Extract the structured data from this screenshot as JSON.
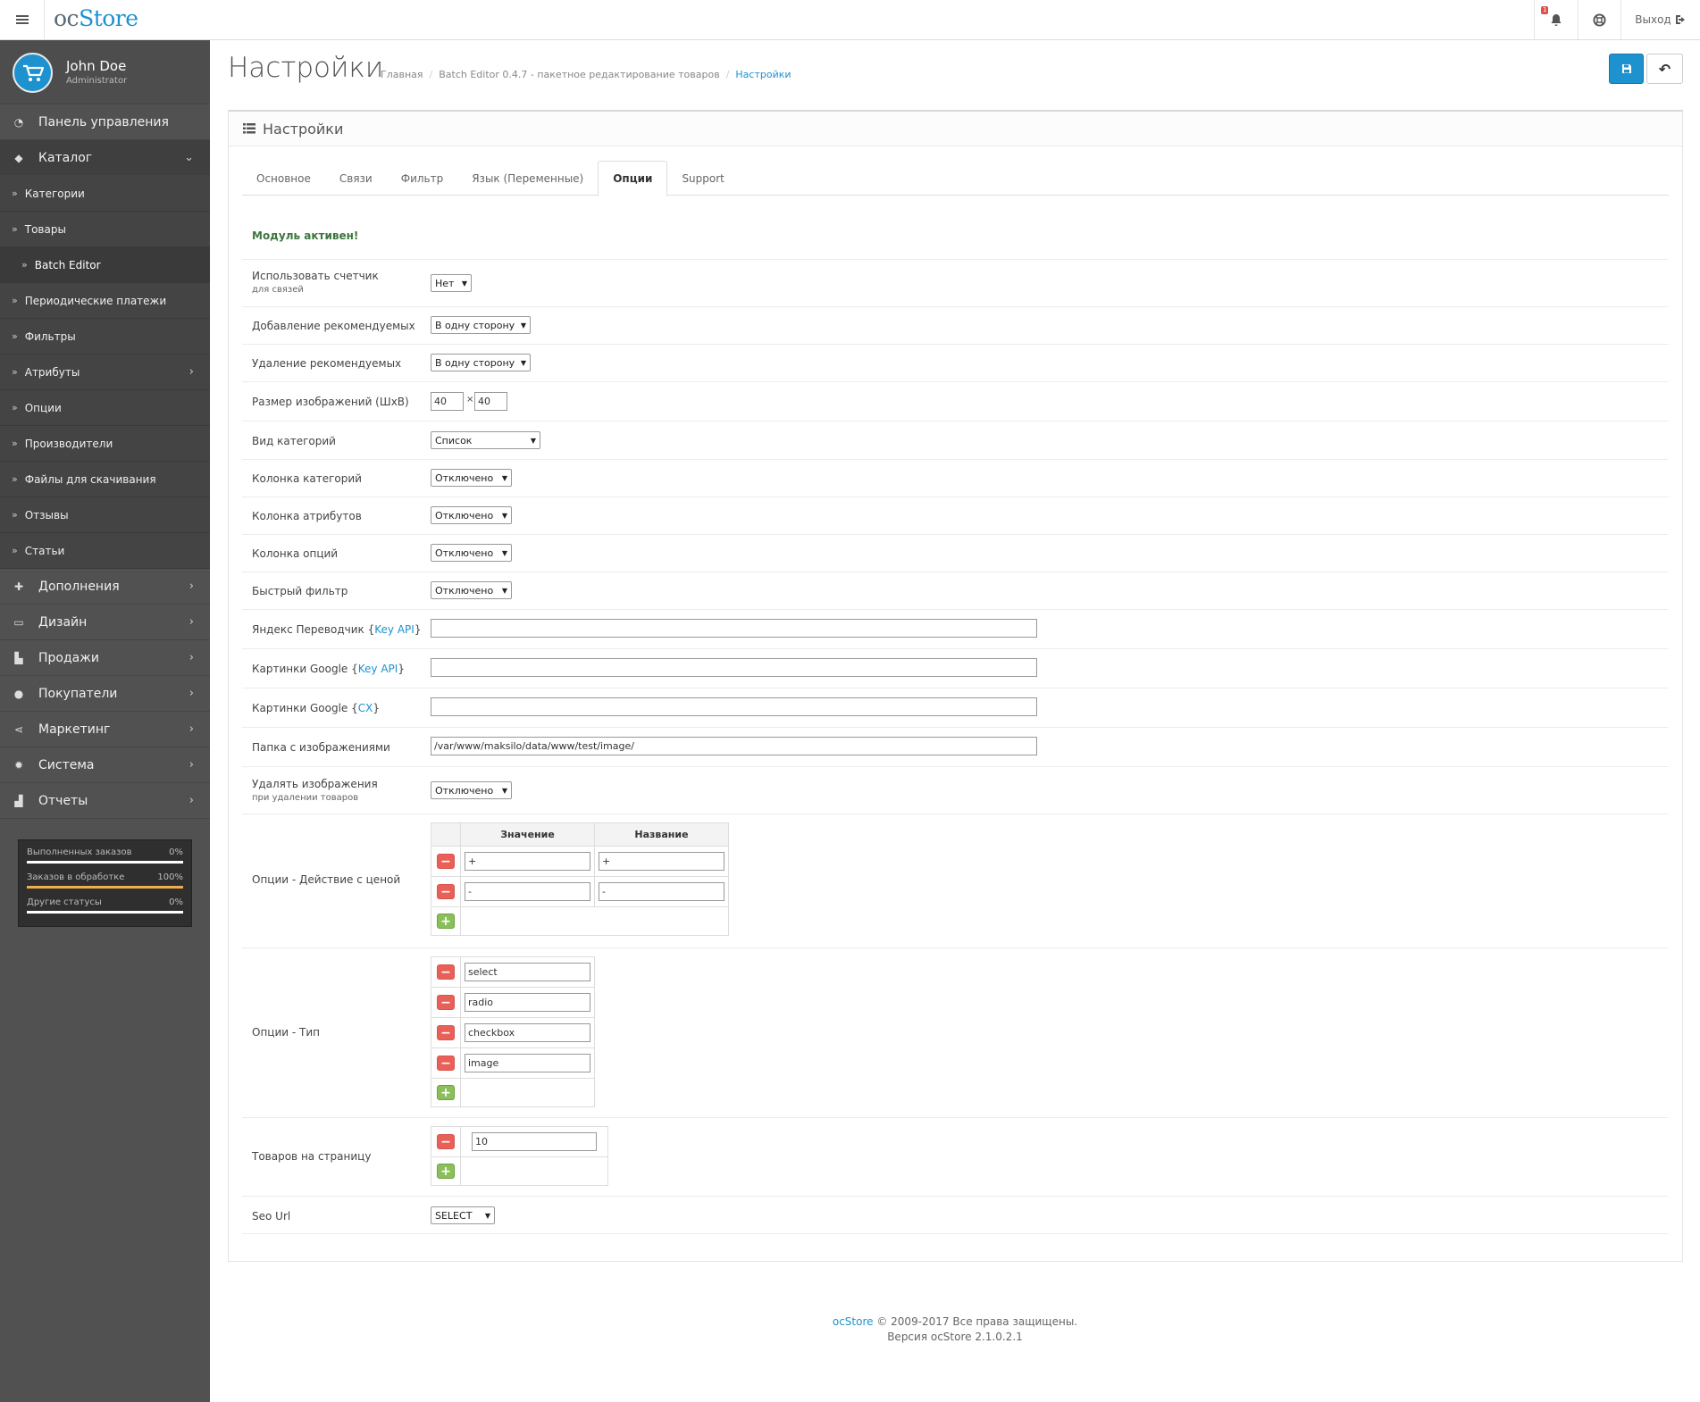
{
  "header": {
    "logo_oc": "oc",
    "logo_store": "Store",
    "notification_count": "1",
    "logout_label": "Выход"
  },
  "user": {
    "name": "John Doe",
    "role": "Administrator"
  },
  "sidebar": {
    "dashboard": "Панель управления",
    "catalog": "Каталог",
    "catalog_items": [
      "Категории",
      "Товары",
      "Batch Editor",
      "Периодические платежи",
      "Фильтры",
      "Атрибуты",
      "Опции",
      "Производители",
      "Файлы для скачивания",
      "Отзывы",
      "Статьи"
    ],
    "extensions": "Дополнения",
    "design": "Дизайн",
    "sales": "Продажи",
    "customers": "Покупатели",
    "marketing": "Маркетинг",
    "system": "Система",
    "reports": "Отчеты"
  },
  "stats": [
    {
      "label": "Выполненных заказов",
      "value": "0%",
      "percent": 0,
      "color": "#ffffff"
    },
    {
      "label": "Заказов в обработке",
      "value": "100%",
      "percent": 100,
      "color": "#f0ad4e"
    },
    {
      "label": "Другие статусы",
      "value": "0%",
      "percent": 0,
      "color": "#ffffff"
    }
  ],
  "page": {
    "title": "Настройки",
    "breadcrumb": [
      "Главная",
      "Batch Editor 0.4.7 - пакетное редактирование товаров",
      "Настройки"
    ],
    "panel_title": "Настройки"
  },
  "tabs": [
    "Основное",
    "Связи",
    "Фильтр",
    "Язык (Переменные)",
    "Опции",
    "Support"
  ],
  "module_status": "Модуль активен!",
  "form": {
    "counter_label": "Использовать счетчик",
    "counter_sub": "для связей",
    "counter_value": "Нет",
    "add_related_label": "Добавление рекомендуемых",
    "add_related_value": "В одну сторону",
    "del_related_label": "Удаление рекомендуемых",
    "del_related_value": "В одну сторону",
    "image_size_label": "Размер изображений (ШхВ)",
    "image_w": "40",
    "image_x": "×",
    "image_h": "40",
    "cat_view_label": "Вид категорий",
    "cat_view_value": "Список",
    "cat_col_label": "Колонка категорий",
    "cat_col_value": "Отключено",
    "attr_col_label": "Колонка атрибутов",
    "attr_col_value": "Отключено",
    "opt_col_label": "Колонка опций",
    "opt_col_value": "Отключено",
    "quick_filter_label": "Быстрый фильтр",
    "quick_filter_value": "Отключено",
    "yandex_label": "Яндекс Переводчик",
    "google_img_label": "Картинки Google",
    "google_cx_label": "Картинки Google",
    "key_api": "Key API",
    "cx": "CX",
    "brace_open": "{",
    "brace_close": "}",
    "image_folder_label": "Папка с изображениями",
    "image_folder_value": "/var/www/maksilo/data/www/test/image/",
    "del_images_label": "Удалять изображения",
    "del_images_sub": "при удалении товаров",
    "del_images_value": "Отключено",
    "price_action_label": "Опции - Действие с ценой",
    "price_col_value": "Значение",
    "price_col_name": "Название",
    "price_rows": [
      {
        "value": "+",
        "name": "+"
      },
      {
        "value": "-",
        "name": "-"
      }
    ],
    "option_type_label": "Опции - Тип",
    "option_types": [
      "select",
      "radio",
      "checkbox",
      "image"
    ],
    "per_page_label": "Товаров на страницу",
    "per_page_value": "10",
    "seo_label": "Seo Url",
    "seo_value": "SELECT"
  },
  "footer": {
    "brand": "ocStore",
    "copyright": "© 2009-2017 Все права защищены.",
    "version": "Версия ocStore 2.1.0.2.1"
  }
}
